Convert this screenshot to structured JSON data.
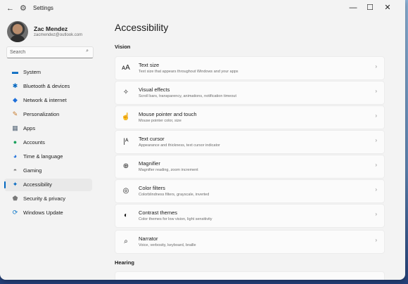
{
  "window": {
    "title": "Settings",
    "minimize": "—",
    "maximize": "☐",
    "close": "✕",
    "back": "←",
    "gear": "⚙"
  },
  "profile": {
    "name": "Zac Mendez",
    "email": "zacmendez@outlook.com"
  },
  "search": {
    "placeholder": "Search",
    "icon": "⌕"
  },
  "nav": [
    {
      "label": "System",
      "icon": "▬",
      "color": "#0067c0"
    },
    {
      "label": "Bluetooth & devices",
      "icon": "✱",
      "color": "#0067c0"
    },
    {
      "label": "Network & internet",
      "icon": "◆",
      "color": "#1e6fd9"
    },
    {
      "label": "Personalization",
      "icon": "✎",
      "color": "#c77a2a"
    },
    {
      "label": "Apps",
      "icon": "▦",
      "color": "#5b6b7c"
    },
    {
      "label": "Accounts",
      "icon": "●",
      "color": "#1aa05c"
    },
    {
      "label": "Time & language",
      "icon": "◕",
      "color": "#1e6fd9"
    },
    {
      "label": "Gaming",
      "icon": "◓",
      "color": "#7a7a7a"
    },
    {
      "label": "Accessibility",
      "icon": "✦",
      "color": "#0067c0",
      "active": true
    },
    {
      "label": "Security & privacy",
      "icon": "⬟",
      "color": "#7a7a7a"
    },
    {
      "label": "Windows Update",
      "icon": "⟳",
      "color": "#0a77c9"
    }
  ],
  "main": {
    "title": "Accessibility",
    "section_vision": "Vision",
    "section_hearing": "Hearing",
    "chevron": "›",
    "cards": [
      {
        "title": "Text size",
        "subtitle": "Text size that appears throughout Windows and your apps",
        "icon": "ᴀA"
      },
      {
        "title": "Visual effects",
        "subtitle": "Scroll bars, transparency, animations, notification timeout",
        "icon": "✧"
      },
      {
        "title": "Mouse pointer and touch",
        "subtitle": "Mouse pointer color, size",
        "icon": "☝"
      },
      {
        "title": "Text cursor",
        "subtitle": "Appearance and thickness, text cursor indicator",
        "icon": "|ᴬ"
      },
      {
        "title": "Magnifier",
        "subtitle": "Magnifier reading, zoom increment",
        "icon": "⊕"
      },
      {
        "title": "Color filters",
        "subtitle": "Colorblindness filters, grayscale, inverted",
        "icon": "◎"
      },
      {
        "title": "Contrast themes",
        "subtitle": "Color themes for low vision, light sensitivity",
        "icon": "◐"
      },
      {
        "title": "Narrator",
        "subtitle": "Voice, verbosity, keyboard, braille",
        "icon": "⌕"
      }
    ]
  }
}
